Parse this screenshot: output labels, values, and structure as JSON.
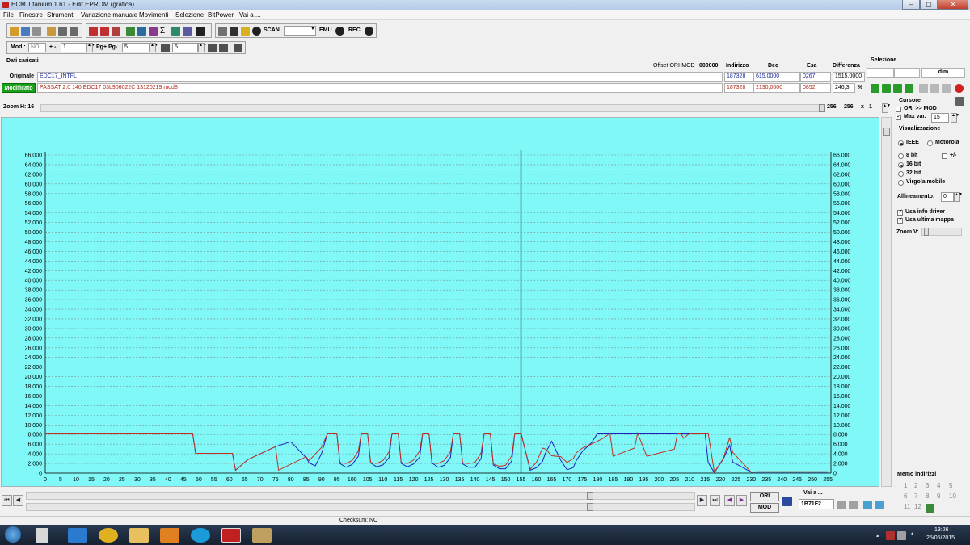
{
  "window": {
    "title": "ECM Titanium 1.61 - Edit EPROM (grafica)",
    "minimize": "‒",
    "maximize": "▢",
    "close": "✕"
  },
  "menu": [
    "File",
    "Finestre",
    "Strumenti",
    "Variazione manuale",
    "Movimenti",
    "Selezione",
    "BitPower",
    "Vai a ..."
  ],
  "toolbar": {
    "scan_label": "SCAN",
    "emu_label": "EMU",
    "rec_label": "REC"
  },
  "toolbar2": {
    "mod_label": "Mod.:",
    "mod_value": "NO",
    "plusminus_label": "+ -",
    "plusminus_value": "1",
    "pg_label": "Pg+ Pg-",
    "pg_value": "5",
    "field3_value": "5"
  },
  "dati": {
    "header": "Dati caricati",
    "offset_label": "Offset ORI-MOD",
    "offset_value": "000000",
    "col_indirizzo": "Indirizzo",
    "col_dec": "Dec",
    "col_esa": "Esa",
    "col_differenza": "Differenza",
    "selezione_label": "Selezione",
    "sel_from": "...",
    "sel_to": "...",
    "dim_label": "dim.",
    "originale": {
      "label": "Originale",
      "name": "EDC17_INTFL",
      "indirizzo": "187328",
      "dec": "615,0000",
      "esa": "0267",
      "differenza": "1515,0000"
    },
    "modificato": {
      "label": "Modificato",
      "name": "PASSAT 2.0 140 EDC17 03L906022C 13120219 mod8",
      "indirizzo": "187328",
      "dec": "2130,0000",
      "esa": "0852",
      "differenza": "246,3",
      "percent": "%"
    }
  },
  "zoom": {
    "label": "Zoom H: 16",
    "value_a": "256",
    "value_b": "256",
    "x_label": "x",
    "multiplier": "1"
  },
  "right_panel": {
    "cursore_label": "Cursore",
    "ori_mod_label": "ORI >> MOD",
    "max_var_label": "Max var.",
    "max_var_value": "15",
    "visualizzazione_label": "Visualizzazione",
    "ieee_label": "IEEE",
    "motorola_label": "Motorola",
    "bit8_label": "8 bit",
    "plusminus_label": "+/-",
    "bit16_label": "16 bit",
    "bit32_label": "32 bit",
    "virgola_label": "Virgola mobile",
    "allineamento_label": "Allineamento:",
    "allineamento_value": "0",
    "usa_info_label": "Usa info driver",
    "usa_ultima_label": "Usa ultima mappa",
    "zoomv_label": "Zoom V:",
    "memo_label": "Memo indirizzi",
    "memo_numbers": [
      "1",
      "2",
      "3",
      "4",
      "5",
      "6",
      "7",
      "8",
      "9",
      "10",
      "11",
      "12"
    ]
  },
  "bottom": {
    "ori_btn": "ORI",
    "mod_btn": "MOD",
    "vai_label": "Vai a ...",
    "vai_value": "1B71F2",
    "checksum": "Checksum: NO"
  },
  "taskbar": {
    "time": "13:26",
    "date": "25/05/2015"
  },
  "chart_data": {
    "type": "line",
    "title": "",
    "xlabel": "",
    "ylabel": "",
    "xlim": [
      0,
      256
    ],
    "ylim": [
      0,
      66000
    ],
    "x_ticks": [
      0,
      5,
      10,
      15,
      20,
      25,
      30,
      35,
      40,
      45,
      50,
      55,
      60,
      65,
      70,
      75,
      80,
      85,
      90,
      95,
      100,
      105,
      110,
      115,
      120,
      125,
      130,
      135,
      140,
      145,
      150,
      155,
      160,
      165,
      170,
      175,
      180,
      185,
      190,
      195,
      200,
      205,
      210,
      215,
      220,
      225,
      230,
      235,
      240,
      245,
      250,
      255
    ],
    "y_ticks": [
      "0",
      "2.000",
      "4.000",
      "6.000",
      "8.000",
      "10.000",
      "12.000",
      "14.000",
      "16.000",
      "18.000",
      "20.000",
      "22.000",
      "24.000",
      "26.000",
      "28.000",
      "30.000",
      "32.000",
      "34.000",
      "36.000",
      "38.000",
      "40.000",
      "42.000",
      "44.000",
      "46.000",
      "48.000",
      "50.000",
      "52.000",
      "54.000",
      "56.000",
      "58.000",
      "60.000",
      "62.000",
      "64.000",
      "66.000"
    ],
    "grid": true,
    "cursor_x": 155,
    "colors": {
      "originale": "#2020c0",
      "modificato": "#c03020",
      "cursor": "#000000",
      "background": "#80f8f8",
      "grid": "#7a9090"
    },
    "series": [
      {
        "key": "originale",
        "x": [
          0,
          48,
          49,
          61,
          62,
          66,
          75,
          80,
          85,
          86,
          88,
          90,
          92,
          93,
          95,
          96,
          98,
          100,
          102,
          103,
          105,
          106,
          108,
          110,
          112,
          113,
          115,
          116,
          118,
          120,
          122,
          123,
          125,
          126,
          128,
          130,
          132,
          133,
          135,
          136,
          138,
          140,
          142,
          143,
          145,
          146,
          148,
          150,
          152,
          153,
          155,
          158,
          160,
          162,
          163,
          165,
          168,
          170,
          172,
          173,
          175,
          178,
          180,
          182,
          183,
          185,
          188,
          192,
          194,
          196,
          205,
          207,
          208,
          210,
          215,
          216,
          218,
          221,
          223,
          224,
          230,
          232,
          233,
          255
        ],
        "y": [
          8300,
          8300,
          4100,
          4100,
          600,
          2800,
          5500,
          6500,
          3200,
          2100,
          1500,
          4000,
          8300,
          8300,
          8300,
          2000,
          1200,
          1800,
          3500,
          8300,
          8300,
          2100,
          1300,
          1700,
          3200,
          8300,
          8300,
          2000,
          1300,
          1900,
          3300,
          8300,
          8300,
          2100,
          1200,
          1600,
          3200,
          8300,
          8300,
          1900,
          1200,
          1200,
          3000,
          8300,
          8300,
          1700,
          900,
          900,
          2500,
          8300,
          8300,
          600,
          1100,
          2400,
          4200,
          6600,
          2600,
          700,
          1100,
          2600,
          4500,
          6300,
          8300,
          8300,
          8300,
          8300,
          8300,
          8300,
          8300,
          8300,
          8300,
          8300,
          8300,
          8300,
          8300,
          2200,
          100,
          3000,
          5800,
          2300,
          200,
          200,
          200,
          200
        ]
      },
      {
        "key": "modificato",
        "x": [
          0,
          48,
          49,
          61,
          62,
          66,
          75,
          76,
          85,
          86,
          90,
          92,
          93,
          95,
          96,
          98,
          100,
          102,
          103,
          105,
          106,
          108,
          110,
          112,
          113,
          115,
          116,
          118,
          120,
          122,
          123,
          125,
          126,
          128,
          130,
          132,
          133,
          135,
          136,
          138,
          140,
          142,
          143,
          145,
          146,
          148,
          150,
          152,
          153,
          155,
          158,
          160,
          162,
          163,
          165,
          168,
          170,
          172,
          173,
          175,
          178,
          182,
          184,
          185,
          192,
          193,
          196,
          205,
          206,
          207,
          208,
          210,
          215,
          216,
          218,
          221,
          223,
          224,
          230,
          232,
          233,
          255
        ],
        "y": [
          8300,
          8300,
          4100,
          4100,
          600,
          2800,
          5500,
          600,
          3400,
          2600,
          5300,
          8300,
          8300,
          8300,
          2200,
          2000,
          2600,
          4600,
          8300,
          8300,
          2200,
          2000,
          2600,
          4400,
          8300,
          8300,
          2200,
          2000,
          2700,
          4600,
          8300,
          8300,
          2100,
          2000,
          2600,
          4400,
          8300,
          8300,
          2100,
          2000,
          2200,
          4200,
          8300,
          8300,
          1900,
          1400,
          1600,
          3600,
          8300,
          8300,
          800,
          2200,
          5200,
          5000,
          3600,
          3400,
          2200,
          3000,
          4200,
          5200,
          6000,
          7300,
          8300,
          3500,
          5200,
          8300,
          3500,
          5000,
          8300,
          8300,
          7200,
          8300,
          8300,
          8300,
          200,
          3100,
          7400,
          4300,
          200,
          300,
          300,
          300
        ]
      }
    ]
  }
}
